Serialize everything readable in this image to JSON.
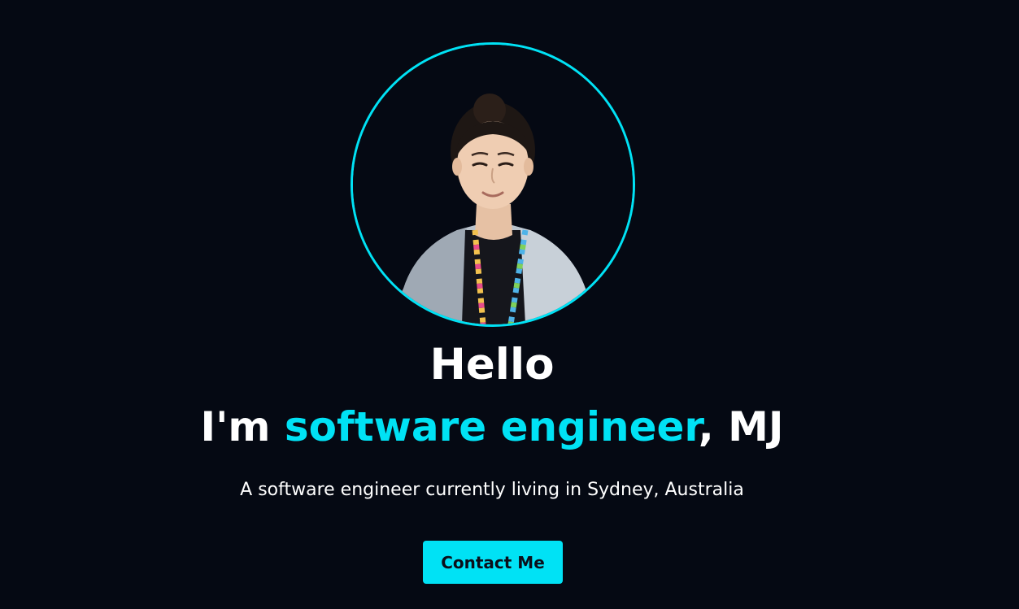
{
  "hero": {
    "greeting": "Hello",
    "headline_prefix": "I'm ",
    "headline_accent": "software engineer",
    "headline_suffix": ", MJ",
    "subtitle": "A software engineer currently living in Sydney, Australia",
    "contact_label": "Contact Me"
  },
  "colors": {
    "background": "#050913",
    "accent": "#00e2f5",
    "text": "#ffffff"
  }
}
